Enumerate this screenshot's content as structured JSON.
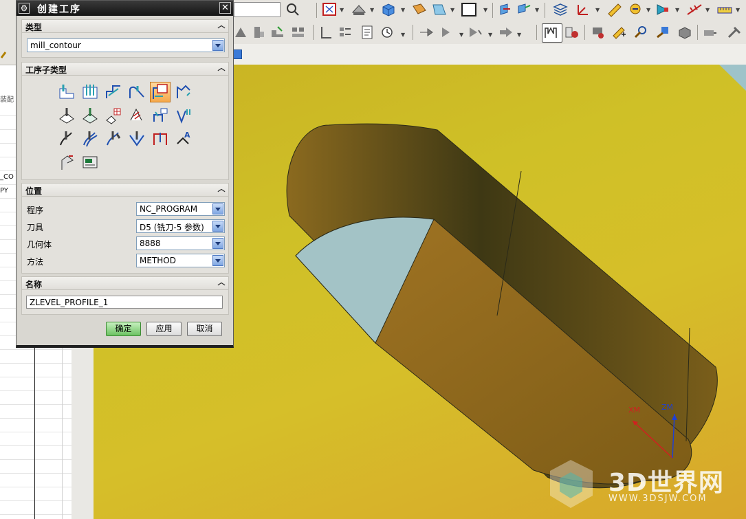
{
  "dialog": {
    "title": "创建工序",
    "sections": {
      "type": "类型",
      "subtype": "工序子类型",
      "location": "位置",
      "name": "名称"
    },
    "type_value": "mill_contour",
    "location": {
      "program_label": "程序",
      "program_value": "NC_PROGRAM",
      "tool_label": "刀具",
      "tool_value": "D5 (铣刀-5 参数)",
      "geometry_label": "几何体",
      "geometry_value": "8888",
      "method_label": "方法",
      "method_value": "METHOD"
    },
    "name_value": "ZLEVEL_PROFILE_1",
    "buttons": {
      "ok": "确定",
      "apply": "应用",
      "cancel": "取消"
    }
  },
  "left_panel": {
    "tab_label": "装配",
    "items": [
      "_CO",
      "PY"
    ]
  },
  "viewport": {
    "axis_x": "XM",
    "axis_z": "ZM"
  },
  "watermark": {
    "main": "3D世界网",
    "sub": "WWW.3DSJW.COM"
  },
  "colors": {
    "titlebar": "#1a1a1a",
    "part_yellow": "#cfc027",
    "wall_brown": "#8a6a1e",
    "floor_blue": "#a4c4c8",
    "ok_green": "#6cc262"
  }
}
